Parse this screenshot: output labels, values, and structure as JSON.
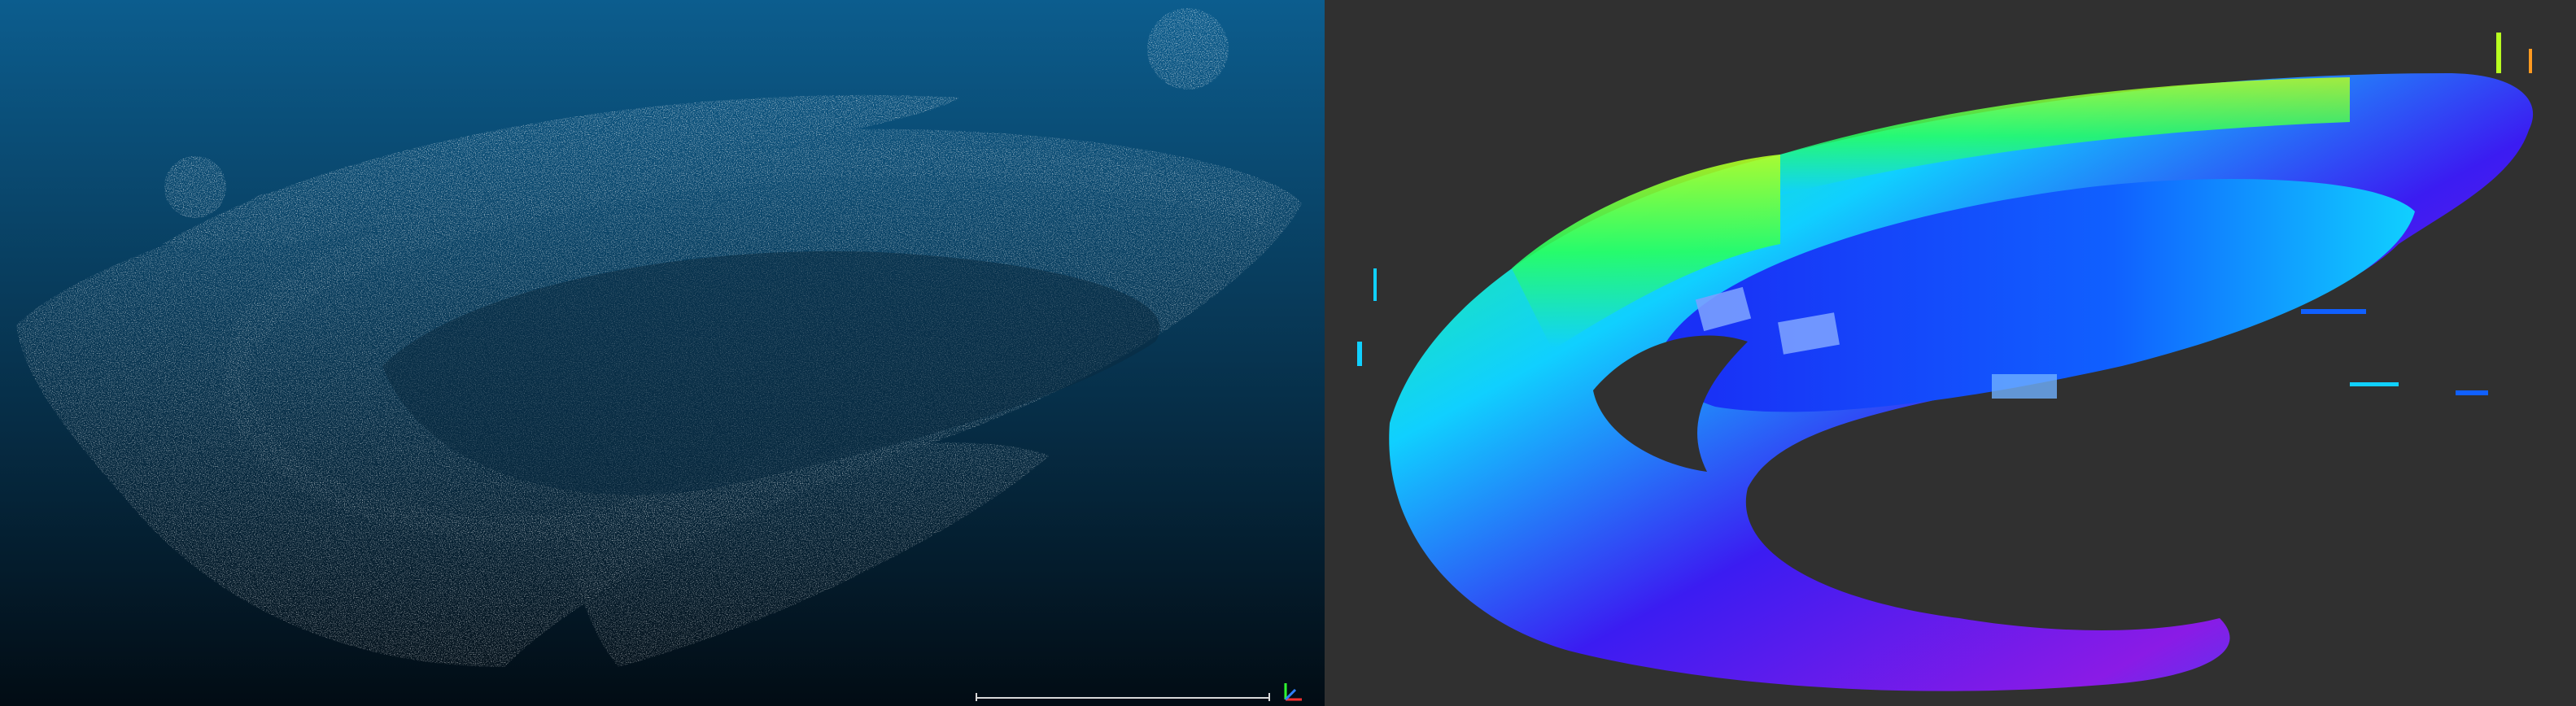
{
  "window": {
    "title": ""
  },
  "left_view": {
    "background_top": "#0c5d8e",
    "background_bottom": "#020c14",
    "point_color": "#ffffff",
    "scale_bar_color": "#d8d8d8",
    "axis_icon": "xyz-axis-icon"
  },
  "right_view": {
    "background": "#303030",
    "height_colormap": [
      "#8a1be6",
      "#3b1cf2",
      "#1060ff",
      "#10d0ff",
      "#28ff60",
      "#b8ff20",
      "#ff9a20"
    ]
  }
}
